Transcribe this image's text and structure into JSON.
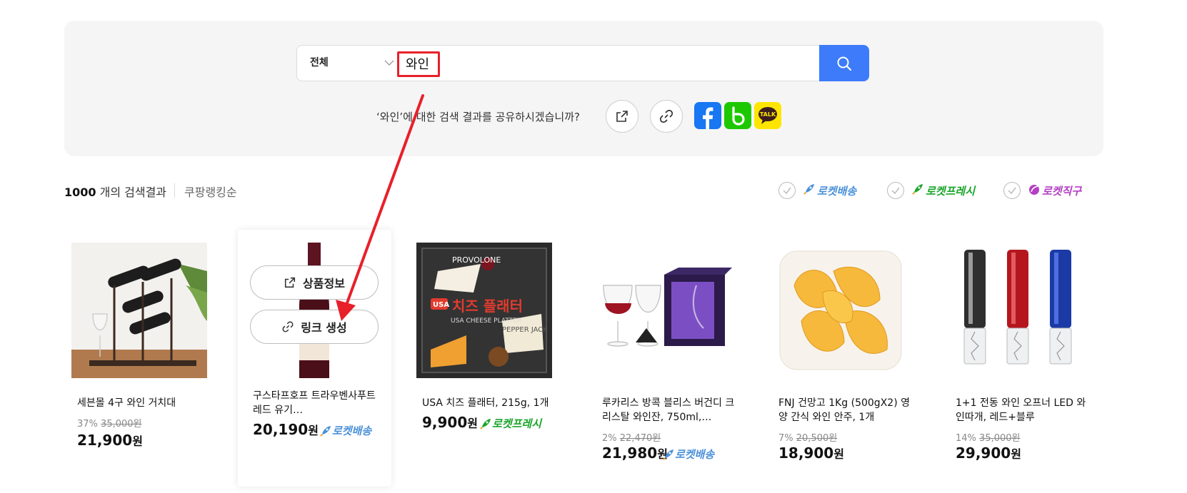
{
  "search": {
    "category": "전체",
    "query": "와인",
    "share_prompt": "‘와인’에 대한 검색 결과를 공유하시겠습니까?"
  },
  "share_buttons": [
    {
      "icon": "external-link-icon"
    },
    {
      "icon": "link-icon"
    },
    {
      "icon": "facebook-icon",
      "color": "#1877f2"
    },
    {
      "icon": "band-icon",
      "color": "#1ec800"
    },
    {
      "icon": "kakaotalk-icon",
      "color": "#fee500",
      "label": "TALK"
    }
  ],
  "results": {
    "count": "1000",
    "count_suffix": " 개의 검색결과",
    "sort": "쿠팡랭킹순"
  },
  "filters": [
    {
      "label": "로켓배송",
      "color": "#4a90d9"
    },
    {
      "label": "로켓프레시",
      "color": "#1aa52a"
    },
    {
      "label": "로켓직구",
      "color": "#b43fc4"
    }
  ],
  "hover_actions": {
    "product_info": "상품정보",
    "create_link": "링크 생성"
  },
  "products": [
    {
      "name": "세븐몰 4구 와인 거치대",
      "discount": "37%",
      "original_price": "35,000원",
      "price": "21,900",
      "unit": "원",
      "badge": ""
    },
    {
      "name": "구스타프호프 트라우벤사푸트 레드 유기…",
      "discount": "",
      "original_price": "",
      "price": "20,190",
      "unit": "원",
      "badge": "로켓배송"
    },
    {
      "name": "USA 치즈 플래터, 215g, 1개",
      "discount": "",
      "original_price": "",
      "price": "9,900",
      "unit": "원",
      "badge": "로켓프레시"
    },
    {
      "name": "루카리스 방콕 블리스 버건디 크리스탈 와인잔, 750ml,…",
      "discount": "2%",
      "original_price": "22,470원",
      "price": "21,980",
      "unit": "원",
      "badge": "로켓배송"
    },
    {
      "name": "FNJ 건망고 1Kg (500gX2) 영양 간식 와인 안주, 1개",
      "discount": "7%",
      "original_price": "20,500원",
      "price": "18,900",
      "unit": "원",
      "badge": ""
    },
    {
      "name": "1+1 전동 와인 오프너 LED 와인따개, 레드+블루",
      "discount": "14%",
      "original_price": "35,000원",
      "price": "29,900",
      "unit": "원",
      "badge": ""
    }
  ],
  "product_images": {
    "cheese_box_text": [
      "PROVOLONE",
      "USA",
      "치즈 플래터",
      "USA CHEESE PLATTER",
      "PEPPER JACK"
    ]
  },
  "colors": {
    "accent": "#3d7bfa",
    "annotation": "#e8202a",
    "panel_bg": "#f5f5f6"
  }
}
